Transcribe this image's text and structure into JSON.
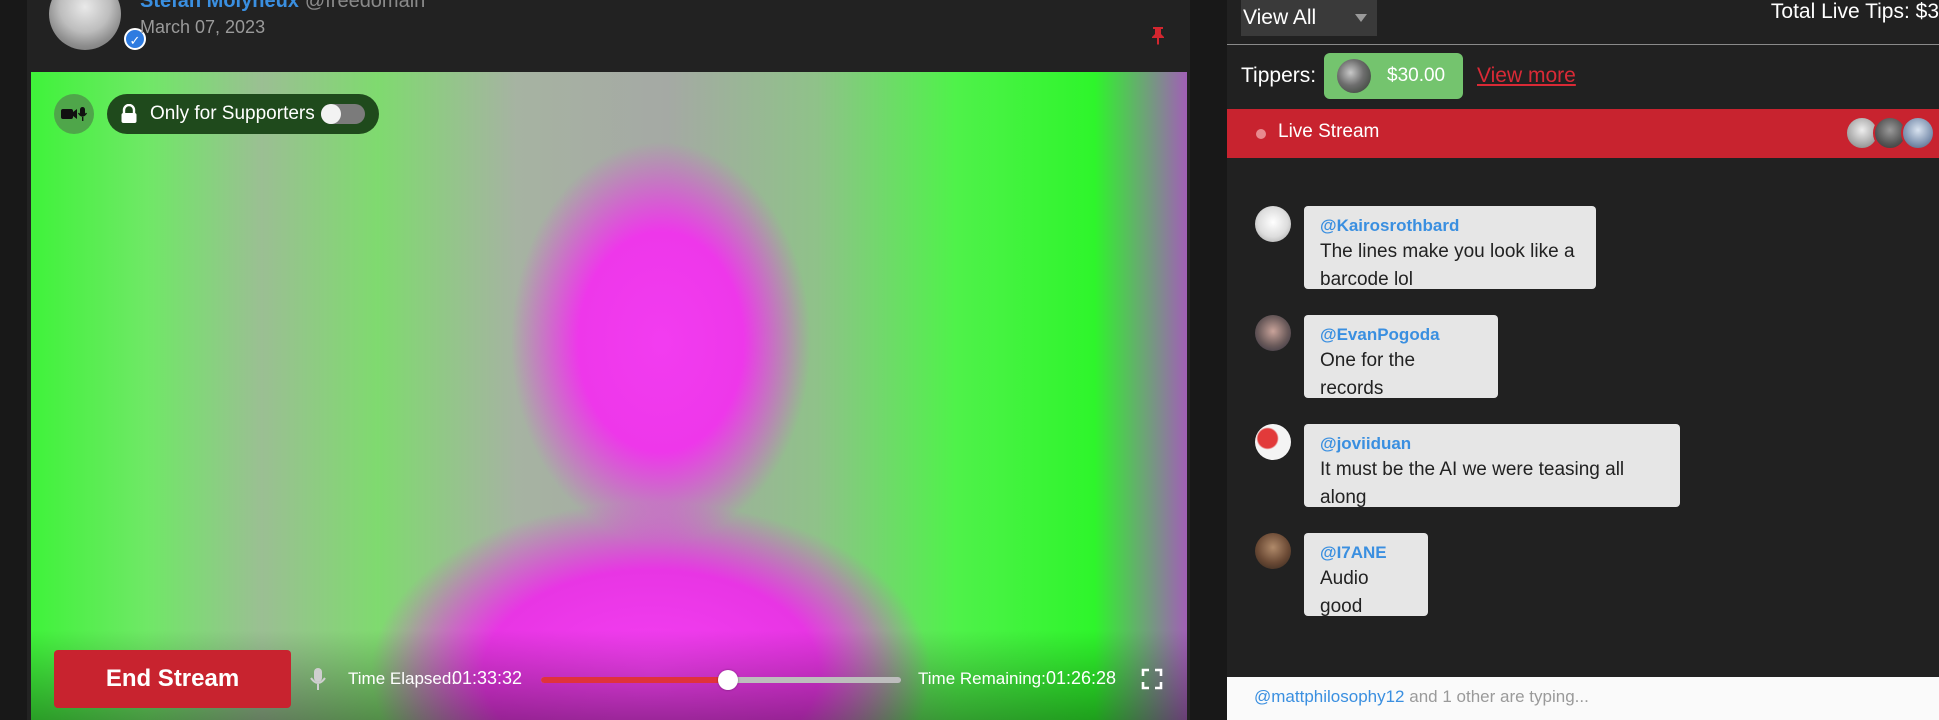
{
  "post": {
    "author_name": "Stefan Molyneux",
    "author_handle": "@freedomain",
    "date": "March 07, 2023",
    "icons": {
      "pin": "pin-icon",
      "verified": "verified-badge-icon"
    }
  },
  "video": {
    "supporters_label": "Only for Supporters",
    "supporters_toggle_on": false,
    "end_stream_label": "End Stream",
    "time_elapsed_label": "Time Elapsed:",
    "time_elapsed": "01:33:32",
    "time_remaining_label": "Time Remaining:",
    "time_remaining": "01:26:28",
    "progress_fraction": 0.52,
    "icons": [
      "camera-mic-icon",
      "lock-icon",
      "mic-icon",
      "fullscreen-icon"
    ],
    "colors": {
      "end_stream": "#c8232f",
      "progress": "#e0323c"
    }
  },
  "sidebar": {
    "filter_value": "View All",
    "total_tips_label": "Total Live Tips: $3",
    "tippers_label": "Tippers:",
    "tip_amount": "$30.00",
    "view_more": "View more",
    "live_label": "Live Stream",
    "colors": {
      "live_bar": "#c8232f",
      "tip_chip": "#74c46e"
    },
    "messages": [
      {
        "user": "@Kairosrothbard",
        "text": "The lines make you look like a barcode lol"
      },
      {
        "user": "@EvanPogoda",
        "text": "One for the records"
      },
      {
        "user": "@joviiduan",
        "text": "It must be the AI we were teasing all along"
      },
      {
        "user": "@I7ANE",
        "text": "Audio good"
      }
    ],
    "typing_user": "@mattphilosophy12",
    "typing_rest": "and 1 other are typing..."
  }
}
